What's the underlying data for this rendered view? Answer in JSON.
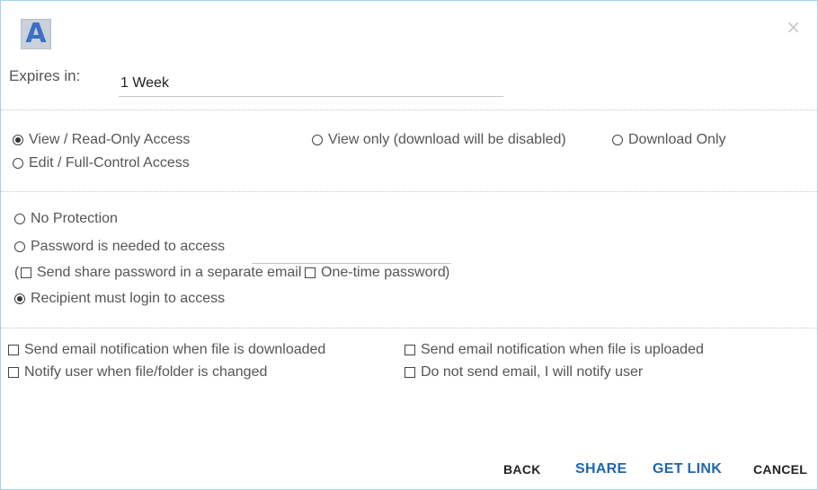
{
  "dialog": {
    "logo_letter": "A",
    "close_glyph": "×"
  },
  "expires": {
    "label": "Expires in:",
    "value": "1 Week"
  },
  "access": {
    "options": [
      {
        "label": "View / Read-Only Access",
        "selected": true
      },
      {
        "label": "View only (download will be disabled)",
        "selected": false
      },
      {
        "label": "Download Only",
        "selected": false
      },
      {
        "label": "Edit / Full-Control Access",
        "selected": false
      }
    ]
  },
  "protection": {
    "no_protection": "No Protection",
    "password_needed": "Password is needed to access",
    "password_value": "",
    "open_paren": "(",
    "close_paren": ")",
    "send_password_separately": "Send share password in a separate email",
    "one_time_password": "One-time password",
    "recipient_login": "Recipient must login to access",
    "selected": "recipient_login"
  },
  "notifications": {
    "on_download": "Send email notification when file is downloaded",
    "on_upload": "Send email notification when file is uploaded",
    "on_change": "Notify user when file/folder is changed",
    "no_email": "Do not send email, I will notify user"
  },
  "buttons": {
    "back": "BACK",
    "share": "SHARE",
    "get_link": "GET LINK",
    "cancel": "CANCEL"
  },
  "colors": {
    "border": "#9fd3f0",
    "primary_button": "#1f65b0",
    "logo_letter": "#3d6fc2",
    "logo_bg": "#c9d1da"
  }
}
